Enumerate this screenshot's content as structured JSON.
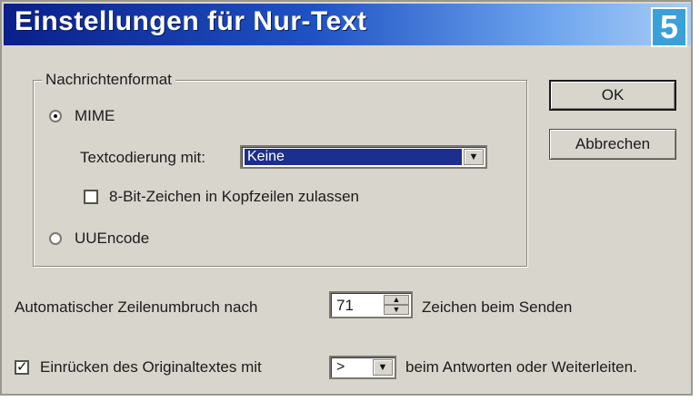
{
  "window": {
    "title": "Einstellungen für Nur-Text",
    "step_badge": "5"
  },
  "group": {
    "legend": "Nachrichtenformat",
    "mime_label": "MIME",
    "mime_selected": true,
    "encoding_label": "Textcodierung mit:",
    "encoding_value": "Keine",
    "allow_8bit_label": "8-Bit-Zeichen in Kopfzeilen zulassen",
    "allow_8bit_checked": false,
    "uuencode_label": "UUEncode",
    "uuencode_selected": false
  },
  "buttons": {
    "ok": "OK",
    "cancel": "Abbrechen"
  },
  "wrap": {
    "label": "Automatischer Zeilenumbruch nach",
    "value": "71",
    "suffix": "Zeichen beim Senden"
  },
  "indent": {
    "label": "Einrücken des Originaltextes mit",
    "checked": true,
    "value": ">",
    "suffix": "beim Antworten oder Weiterleiten."
  },
  "icons": {
    "checkmark": "check-icon",
    "dropdown": "chevron-down-icon",
    "spin_up": "arrow-up-icon",
    "spin_down": "arrow-down-icon"
  },
  "colors": {
    "titlebar_start": "#0a1f8a",
    "titlebar_end": "#a9cdf7",
    "dialog_bg": "#d8d5cd",
    "selection": "#1c2f8e",
    "badge": "#3aa0d8"
  }
}
